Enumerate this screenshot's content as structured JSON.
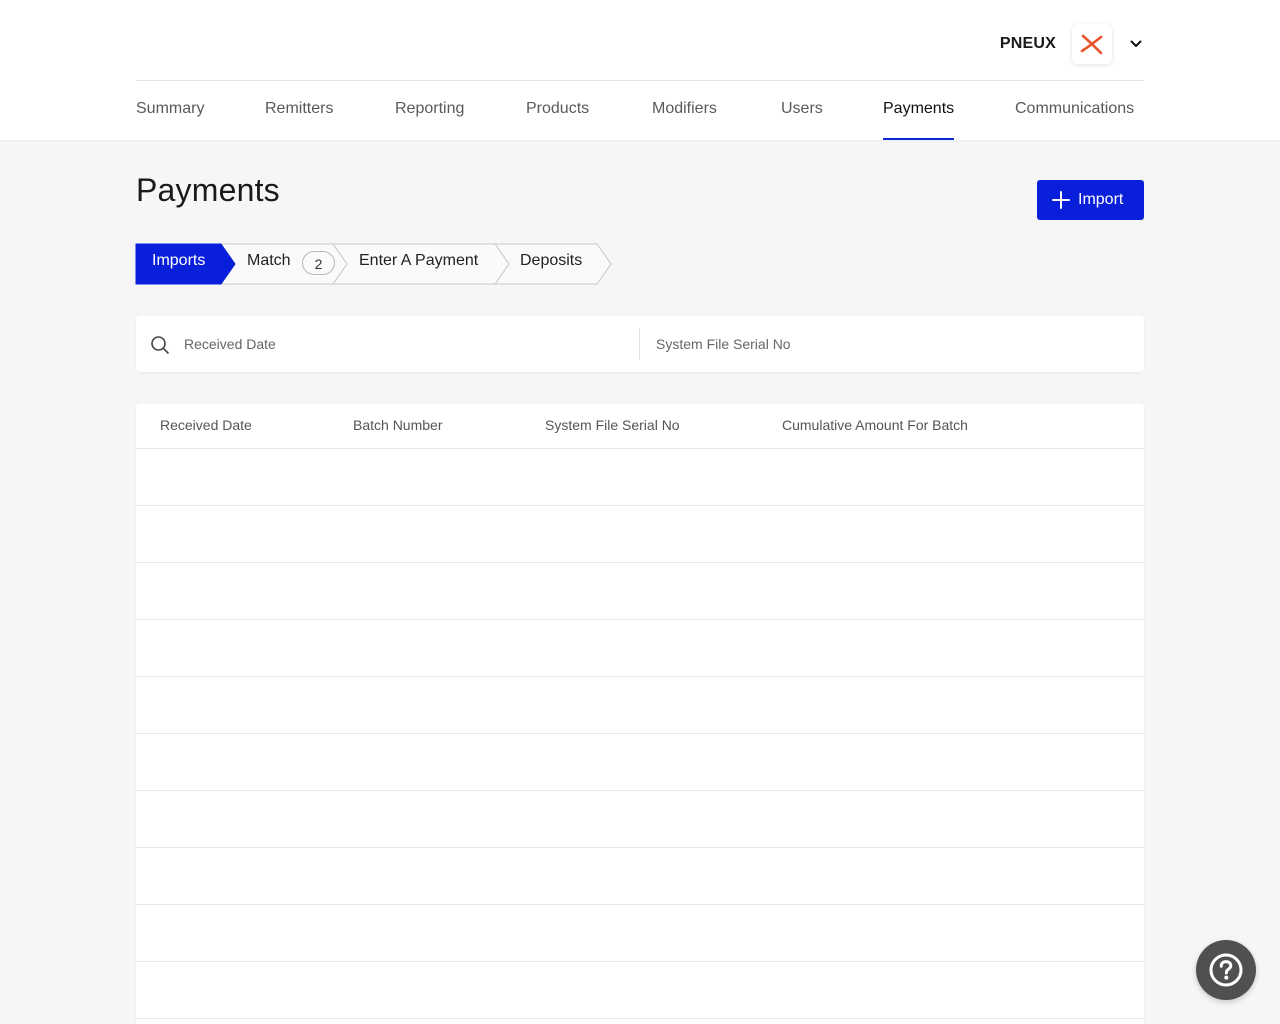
{
  "account": {
    "name": "PNEUX",
    "logo_icon": "brand-x-logo",
    "logo_color": "#e8532a"
  },
  "nav": {
    "items": [
      {
        "label": "Summary"
      },
      {
        "label": "Remitters"
      },
      {
        "label": "Reporting"
      },
      {
        "label": "Products"
      },
      {
        "label": "Modifiers"
      },
      {
        "label": "Users"
      },
      {
        "label": "Payments",
        "active": true
      },
      {
        "label": "Communications"
      }
    ],
    "active_color": "#0a29d6"
  },
  "page": {
    "title": "Payments",
    "import_button": "Import",
    "accent": "#0a1fd9"
  },
  "steps": {
    "items": [
      {
        "label": "Imports",
        "active": true
      },
      {
        "label": "Match",
        "badge": "2"
      },
      {
        "label": "Enter A Payment"
      },
      {
        "label": "Deposits"
      }
    ]
  },
  "filters": {
    "received_date_placeholder": "Received Date",
    "serial_placeholder": "System File Serial No"
  },
  "table": {
    "columns": [
      "Received Date",
      "Batch Number",
      "System File Serial No",
      "Cumulative Amount For Batch"
    ],
    "rows": [
      [],
      [],
      [],
      [],
      [],
      [],
      [],
      [],
      [],
      []
    ]
  },
  "help": {
    "icon": "help-question-icon"
  }
}
